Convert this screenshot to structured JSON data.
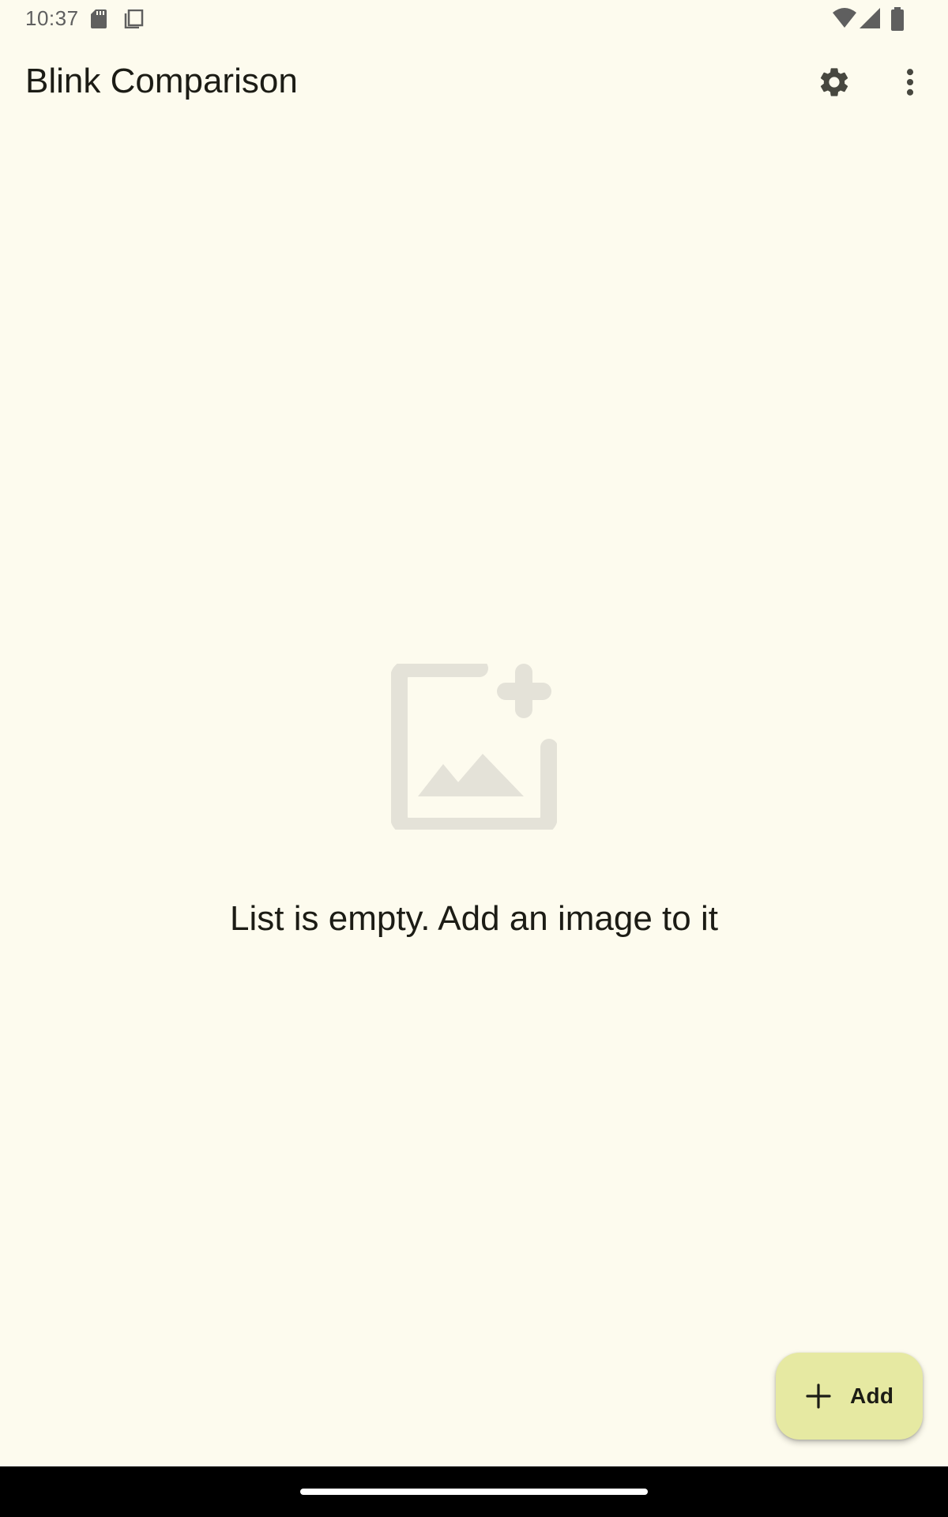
{
  "status_bar": {
    "time": "10:37",
    "icons": [
      "sd-card-icon",
      "copy-icon",
      "wifi-icon",
      "cellular-signal-icon",
      "battery-icon"
    ]
  },
  "app_bar": {
    "title": "Blink Comparison",
    "actions": [
      "settings-icon",
      "more-vert-icon"
    ]
  },
  "empty_state": {
    "icon": "add-photo-icon",
    "message": "List is empty. Add an image to it"
  },
  "fab": {
    "icon": "plus-icon",
    "label": "Add"
  },
  "colors": {
    "background": "#FDFBEE",
    "fab_background": "#E6E9A2",
    "empty_icon": "#E4E2D8",
    "text": "#1C1C15",
    "icon_dark": "#47473F"
  }
}
